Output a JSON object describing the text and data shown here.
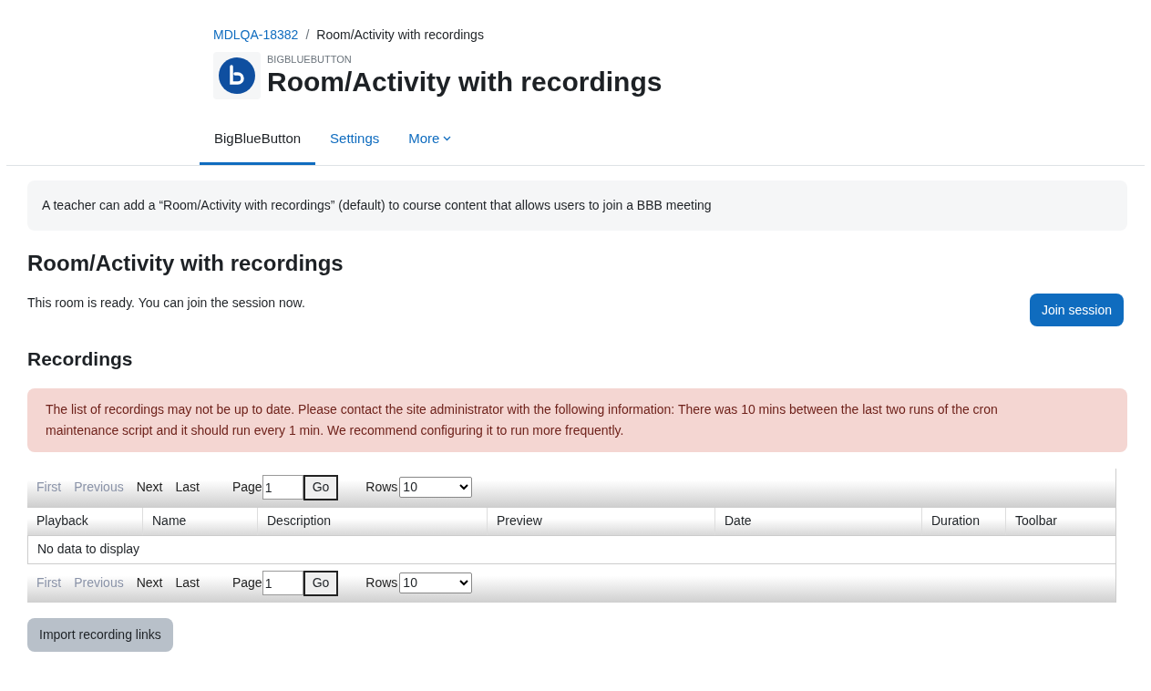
{
  "breadcrumb": {
    "separator": "/",
    "items": [
      {
        "label": "MDLQA-18382",
        "link": true
      },
      {
        "label": "Room/Activity with recordings",
        "link": false
      }
    ]
  },
  "header": {
    "module": "BIGBLUEBUTTON",
    "title": "Room/Activity with recordings"
  },
  "tabs": [
    {
      "label": "BigBlueButton",
      "selected": true,
      "dropdown": false
    },
    {
      "label": "Settings",
      "selected": false,
      "dropdown": false
    },
    {
      "label": "More",
      "selected": false,
      "dropdown": true
    }
  ],
  "intro": "A teacher can add a “Room/Activity with recordings” (default) to course content that allows users to join a BBB meeting",
  "room": {
    "title": "Room/Activity with recordings",
    "status": "This room is ready. You can join the session now.",
    "join_button": "Join session"
  },
  "recordings": {
    "title": "Recordings",
    "alert": "The list of recordings may not be up to date. Please contact the site administrator with the following information: There was 10 mins between the last two runs of the cron maintenance script and it should run every 1 min. We recommend configuring it to run more frequently.",
    "paginators": [
      {
        "links": [
          {
            "label": "First",
            "disabled": true
          },
          {
            "label": "Previous",
            "disabled": true
          },
          {
            "label": "Next",
            "disabled": false
          },
          {
            "label": "Last",
            "disabled": false
          }
        ],
        "page_label": "Page",
        "page_value": "1",
        "go": "Go",
        "rows_label": "Rows",
        "rows_value": "10"
      },
      {
        "links": [
          {
            "label": "First",
            "disabled": true
          },
          {
            "label": "Previous",
            "disabled": true
          },
          {
            "label": "Next",
            "disabled": false
          },
          {
            "label": "Last",
            "disabled": false
          }
        ],
        "page_label": "Page",
        "page_value": "1",
        "go": "Go",
        "rows_label": "Rows",
        "rows_value": "10"
      }
    ],
    "columns": [
      "Playback",
      "Name",
      "Description",
      "Preview",
      "Date",
      "Duration",
      "Toolbar"
    ],
    "empty_message": "No data to display",
    "import_button": "Import recording links"
  }
}
